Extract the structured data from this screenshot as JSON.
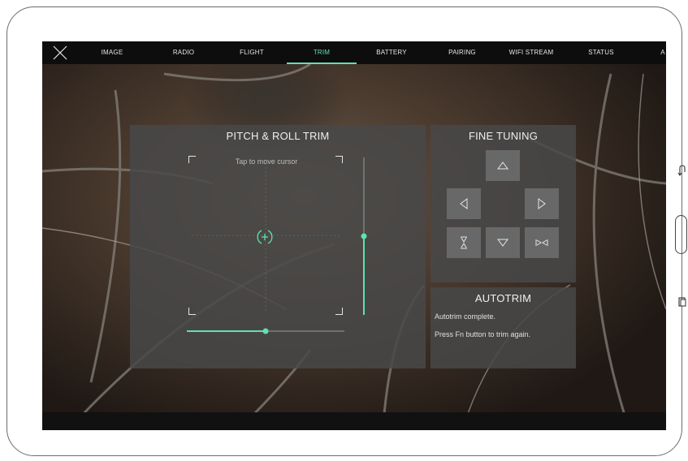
{
  "nav": {
    "tabs": [
      {
        "label": "IMAGE"
      },
      {
        "label": "RADIO"
      },
      {
        "label": "FLIGHT"
      },
      {
        "label": "TRIM",
        "active": true
      },
      {
        "label": "BATTERY"
      },
      {
        "label": "PAIRING"
      },
      {
        "label": "WIFI STREAM"
      },
      {
        "label": "STATUS"
      },
      {
        "label": "A"
      }
    ]
  },
  "trim": {
    "title": "PITCH & ROLL TRIM",
    "hint": "Tap to move cursor",
    "pitch_level": 0.5,
    "roll_level": 0.5
  },
  "fine_tuning": {
    "title": "FINE TUNING"
  },
  "autotrim": {
    "title": "AUTOTRIM",
    "status": "Autotrim complete.",
    "instruction": "Press Fn button to trim again."
  },
  "colors": {
    "accent": "#5ee2b0",
    "panel": "#484848",
    "topbar": "#0d0d0d"
  },
  "icons": {
    "close": "close-icon",
    "up": "arrow-up-icon",
    "down": "arrow-down-icon",
    "left": "arrow-left-icon",
    "right": "arrow-right-icon",
    "compress_vertical": "compress-vertical-icon",
    "compress_horizontal": "compress-horizontal-icon",
    "cursor": "trim-cursor-icon"
  }
}
